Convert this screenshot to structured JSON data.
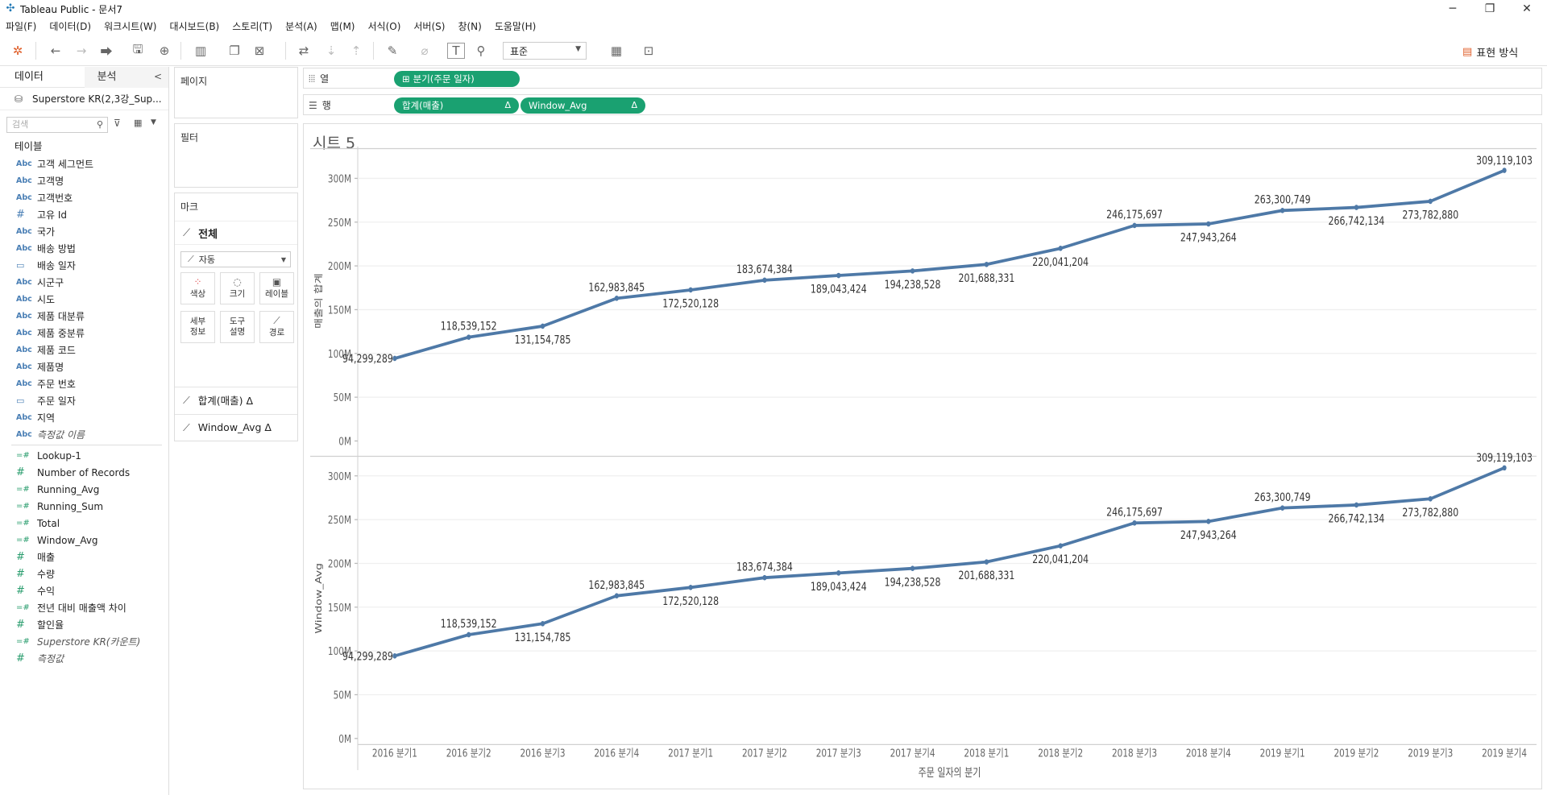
{
  "window": {
    "title": "Tableau Public - 문서7"
  },
  "menu": [
    "파일(F)",
    "데이터(D)",
    "워크시트(W)",
    "대시보드(B)",
    "스토리(T)",
    "분석(A)",
    "맵(M)",
    "서식(O)",
    "서버(S)",
    "창(N)",
    "도움말(H)"
  ],
  "toolbar": {
    "fit": "표준",
    "show_me": "표현 방식"
  },
  "data_pane": {
    "tab_data": "데이터",
    "tab_analysis": "분석",
    "datasource": "Superstore KR(2,3강_Sup...",
    "search_placeholder": "검색",
    "tables_label": "테이블",
    "dimensions": [
      {
        "type": "Abc",
        "name": "고객 세그먼트"
      },
      {
        "type": "Abc",
        "name": "고객명"
      },
      {
        "type": "Abc",
        "name": "고객번호"
      },
      {
        "type": "#",
        "name": "고유 Id"
      },
      {
        "type": "Abc",
        "name": "국가"
      },
      {
        "type": "Abc",
        "name": "배송 방법"
      },
      {
        "type": "date",
        "name": "배송 일자"
      },
      {
        "type": "Abc",
        "name": "시군구"
      },
      {
        "type": "Abc",
        "name": "시도"
      },
      {
        "type": "Abc",
        "name": "제품 대분류"
      },
      {
        "type": "Abc",
        "name": "제품 중분류"
      },
      {
        "type": "Abc",
        "name": "제품 코드"
      },
      {
        "type": "Abc",
        "name": "제품명"
      },
      {
        "type": "Abc",
        "name": "주문 번호"
      },
      {
        "type": "date",
        "name": "주문 일자"
      },
      {
        "type": "Abc",
        "name": "지역"
      },
      {
        "type": "Abc",
        "name": "측정값 이름",
        "italic": true
      }
    ],
    "measures": [
      {
        "type": "=#",
        "name": "Lookup-1"
      },
      {
        "type": "#",
        "name": "Number of Records"
      },
      {
        "type": "=#",
        "name": "Running_Avg"
      },
      {
        "type": "=#",
        "name": "Running_Sum"
      },
      {
        "type": "=#",
        "name": "Total"
      },
      {
        "type": "=#",
        "name": "Window_Avg"
      },
      {
        "type": "#",
        "name": "매출"
      },
      {
        "type": "#",
        "name": "수량"
      },
      {
        "type": "#",
        "name": "수익"
      },
      {
        "type": "=#",
        "name": "전년 대비 매출액 차이"
      },
      {
        "type": "#",
        "name": "할인율"
      },
      {
        "type": "=#",
        "name": "Superstore KR(카운트)",
        "italic": true
      },
      {
        "type": "#",
        "name": "측정값",
        "italic": true
      }
    ]
  },
  "cards": {
    "pages": "페이지",
    "filters": "필터",
    "marks": "마크",
    "marks_all": "전체",
    "mark_type": "자동",
    "buttons": [
      "색상",
      "크기",
      "레이블",
      "세부\n정보",
      "도구\n설명",
      "경로"
    ],
    "measure_rows": [
      "합계(매출) Δ",
      "Window_Avg Δ"
    ]
  },
  "shelves": {
    "columns_label": "열",
    "rows_label": "행",
    "columns_pill": "분기(주문 일자)",
    "rows_pills": [
      "합계(매출)",
      "Window_Avg"
    ],
    "delta": "Δ"
  },
  "sheet": {
    "title": "시트 5"
  },
  "chart_data": {
    "type": "line",
    "categories": [
      "2016 분기1",
      "2016 분기2",
      "2016 분기3",
      "2016 분기4",
      "2017 분기1",
      "2017 분기2",
      "2017 분기3",
      "2017 분기4",
      "2018 분기1",
      "2018 분기2",
      "2018 분기3",
      "2018 분기4",
      "2019 분기1",
      "2019 분기2",
      "2019 분기3",
      "2019 분기4"
    ],
    "xlabel": "주문 일자의 분기",
    "color": "#4e79a7",
    "ylim": [
      0,
      320000000
    ],
    "yticks": [
      "0M",
      "50M",
      "100M",
      "150M",
      "200M",
      "250M",
      "300M"
    ],
    "panes": [
      {
        "ylabel": "매출의 합계",
        "values": [
          94299289,
          118539152,
          131154785,
          162983845,
          172520128,
          183674384,
          189043424,
          194238528,
          201688331,
          220041204,
          246175697,
          247943264,
          263300749,
          266742134,
          273782880,
          309119103
        ]
      },
      {
        "ylabel": "Window_Avg",
        "values": [
          94299289,
          118539152,
          131154785,
          162983845,
          172520128,
          183674384,
          189043424,
          194238528,
          201688331,
          220041204,
          246175697,
          247943264,
          263300749,
          266742134,
          273782880,
          309119103
        ]
      }
    ],
    "data_labels": [
      "94,299,289",
      "118,539,152",
      "131,154,785",
      "162,983,845",
      "172,520,128",
      "183,674,384",
      "189,043,424",
      "194,238,528",
      "201,688,331",
      "220,041,204",
      "246,175,697",
      "247,943,264",
      "263,300,749",
      "266,742,134",
      "273,782,880",
      "309,119,103"
    ]
  }
}
